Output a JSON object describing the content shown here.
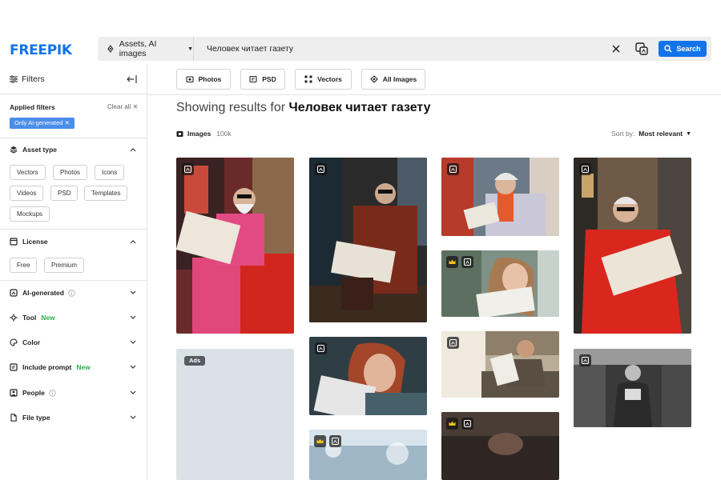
{
  "brand": {
    "logo_text": "FREEPIK",
    "accent": "#1273eb"
  },
  "search": {
    "asset_select_label": "Assets, AI images",
    "query": "Человек читает газету",
    "search_button_label": "Search"
  },
  "sidebar": {
    "title": "Filters",
    "applied_filters_label": "Applied filters",
    "clear_all_label": "Clear all",
    "active_filter_chip": "Only AI-generated",
    "sections": [
      {
        "label": "Asset type",
        "expanded": true,
        "options": [
          "Vectors",
          "Photos",
          "Icons",
          "Videos",
          "PSD",
          "Templates",
          "Mockups"
        ]
      },
      {
        "label": "License",
        "expanded": true,
        "options": [
          "Free",
          "Premium"
        ]
      },
      {
        "label": "AI-generated",
        "expanded": false,
        "has_info": true
      },
      {
        "label": "Tool",
        "expanded": false,
        "badge": "New"
      },
      {
        "label": "Color",
        "expanded": false
      },
      {
        "label": "Include prompt",
        "expanded": false,
        "badge": "New"
      },
      {
        "label": "People",
        "expanded": false,
        "has_info": true
      },
      {
        "label": "File type",
        "expanded": false
      }
    ]
  },
  "type_tabs": [
    "Photos",
    "PSD",
    "Vectors",
    "All Images"
  ],
  "results": {
    "prefix": "Showing results for ",
    "query": "Человек читает газету",
    "images_label": "Images",
    "images_count": "100k",
    "sort_label": "Sort by:",
    "sort_value": "Most relevant",
    "ads_label": "Ads"
  },
  "thumbnails": [
    {
      "id": "old-man-pink-suit-red-chair",
      "premium": false
    },
    {
      "id": "old-man-leather-jacket-bench",
      "premium": false
    },
    {
      "id": "old-man-grey-hair-street",
      "premium": false
    },
    {
      "id": "old-man-red-suit-cafe",
      "premium": false
    },
    {
      "id": "girl-reading-paper",
      "premium": true
    },
    {
      "id": "redhead-woman-reading",
      "premium": false
    },
    {
      "id": "man-reading-window",
      "premium": false
    },
    {
      "id": "man-reading-subway-bw",
      "premium": false
    },
    {
      "id": "man-dark-portrait",
      "premium": true
    },
    {
      "id": "snowy-scene",
      "premium": true
    }
  ]
}
